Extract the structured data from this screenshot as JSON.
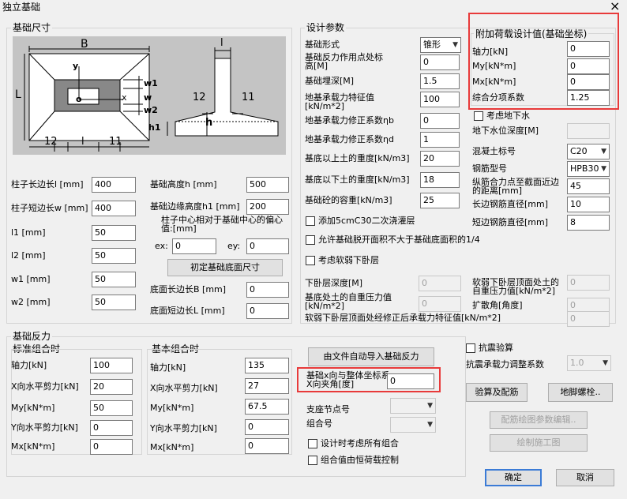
{
  "window": {
    "title": "独立基础",
    "close_glyph": "×"
  },
  "dimension_group": {
    "title": "基础尺寸",
    "diagram": {
      "B": "B",
      "L": "L",
      "y": "y",
      "x": "x",
      "o": "o",
      "w1": "w1",
      "w": "w",
      "w2": "w2",
      "h1": "h1",
      "h": "h",
      "l12_bottom": "12",
      "l_bottom": "l",
      "l11_bottom": "11",
      "l_top": "l",
      "l12_side": "12",
      "l11_side": "11"
    },
    "fields": {
      "col_long_label": "柱子长边长l [mm]",
      "col_long_value": "400",
      "col_short_label": "柱子短边长w [mm]",
      "col_short_value": "400",
      "l1_label": "l1 [mm]",
      "l1_value": "50",
      "l2_label": "l2 [mm]",
      "l2_value": "50",
      "w1_label": "w1 [mm]",
      "w1_value": "50",
      "w2_label": "w2 [mm]",
      "w2_value": "50",
      "height_label": "基础高度h [mm]",
      "height_value": "500",
      "edge_height_label": "基础边缘高度h1 [mm]",
      "edge_height_value": "200",
      "eccentric_label": "柱子中心相对于基础中心的偏心值:[mm]",
      "ex_label": "ex:",
      "ex_value": "0",
      "ey_label": "ey:",
      "ey_value": "0",
      "init_button": "初定基础底面尺寸",
      "bottom_long_label": "底面长边长B [mm]",
      "bottom_long_value": "0",
      "bottom_short_label": "底面短边长L [mm]",
      "bottom_short_value": "0"
    }
  },
  "design_group": {
    "title": "设计参数",
    "form_label": "基础形式",
    "form_value": "锥形",
    "reaction_point_label": "基础反力作用点处标高[M]",
    "reaction_point_value": "0",
    "depth_label": "基础埋深[M]",
    "depth_value": "1.5",
    "bearing_label": "地基承载力特征值[kN/m*2]",
    "bearing_value": "100",
    "eta_b_label": "地基承载力修正系数ηb",
    "eta_b_value": "0",
    "eta_d_label": "地基承载力修正系数ηd",
    "eta_d_value": "1",
    "soil_above_label": "基底以上土的重度[kN/m3]",
    "soil_above_value": "20",
    "soil_below_label": "基底以下土的重度[kN/m3]",
    "soil_below_value": "18",
    "concrete_weight_label": "基础砼的容重[kN/m3]",
    "concrete_weight_value": "25",
    "add_layer_label": "添加5cmC30二次浇灌层",
    "allow_off_label": "允许基础脱开面积不大于基础底面积的1/4",
    "weak_layer_label": "考虑软弱下卧层",
    "groundwater_label": "考虑地下水",
    "groundwater_depth_label": "地下水位深度[M]",
    "groundwater_depth_value": "",
    "concrete_grade_label": "混凝土标号",
    "concrete_grade_value": "C20",
    "rebar_type_label": "钢筋型号",
    "rebar_type_value": "HPB30",
    "rebar_dist_label": "纵筋合力点至截面近边的距离[mm]",
    "rebar_dist_value": "45",
    "long_dia_label": "长边钢筋直径[mm]",
    "long_dia_value": "10",
    "short_dia_label": "短边钢筋直径[mm]",
    "short_dia_value": "8",
    "weak_depth_label": "下卧层深度[M]",
    "weak_depth_value": "0",
    "self_pressure_label": "基底处土的自重压力值[kN/m*2]",
    "self_pressure_value": "0",
    "weak_top_label": "软弱下卧层顶面处土的自重压力值[kN/m*2]",
    "weak_top_value": "0",
    "spread_label": "扩散角[角度]",
    "spread_value": "0",
    "weak_bearing_label": "软弱下卧层顶面处经修正后承载力特征值[kN/m*2]",
    "weak_bearing_value": "0"
  },
  "extra_load_group": {
    "title": "附加荷载设计值(基础坐标)",
    "axial_label": "轴力[kN]",
    "axial_value": "0",
    "my_label": "My[kN*m]",
    "my_value": "0",
    "mx_label": "Mx[kN*m]",
    "mx_value": "0",
    "factor_label": "综合分项系数",
    "factor_value": "1.25"
  },
  "reaction_group": {
    "title": "基础反力",
    "standard_title": "标准组合时",
    "basic_title": "基本组合时",
    "standard": [
      {
        "label": "轴力[kN]",
        "value": "100"
      },
      {
        "label": "X向水平剪力[kN]",
        "value": "20"
      },
      {
        "label": "My[kN*m]",
        "value": "50"
      },
      {
        "label": "Y向水平剪力[kN]",
        "value": "0"
      },
      {
        "label": "Mx[kN*m]",
        "value": "0"
      }
    ],
    "basic": [
      {
        "label": "轴力[kN]",
        "value": "135"
      },
      {
        "label": "X向水平剪力[kN]",
        "value": "27"
      },
      {
        "label": "My[kN*m]",
        "value": "67.5"
      },
      {
        "label": "Y向水平剪力[kN]",
        "value": "0"
      },
      {
        "label": "Mx[kN*m]",
        "value": "0"
      }
    ],
    "import_button": "由文件自动导入基础反力",
    "angle_label": "基础x向与整体坐标系X向夹角[度]",
    "angle_value": "0",
    "node_label": "支座节点号",
    "node_value": "",
    "group_label": "组合号",
    "group_value": "",
    "all_combo_label": "设计时考虑所有组合",
    "dead_ctrl_label": "组合值由恒荷载控制"
  },
  "seismic": {
    "check_label": "抗震验算",
    "factor_label": "抗震承载力调整系数",
    "factor_value": "1.0"
  },
  "buttons": {
    "check_rebar": "验算及配筋",
    "anchor_bolt": "地脚螺栓..",
    "rebar_param": "配筋绘图参数编辑..",
    "draw": "绘制施工图",
    "ok": "确定",
    "cancel": "取消"
  }
}
